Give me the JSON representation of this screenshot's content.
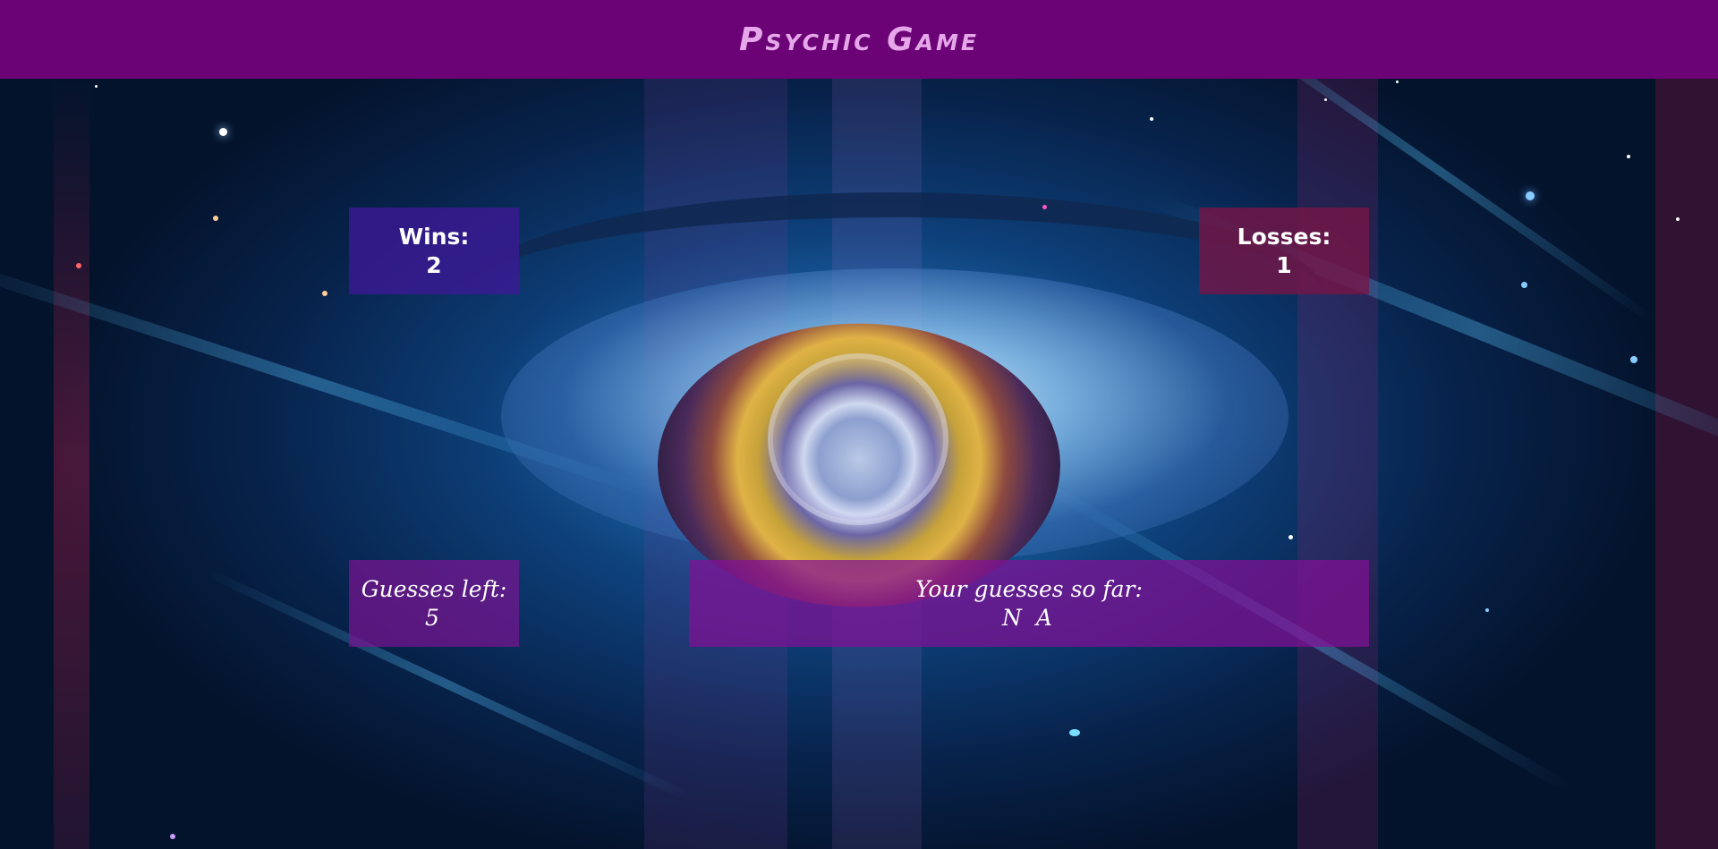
{
  "header": {
    "title": "Psychic Game"
  },
  "stats": {
    "wins_label": "Wins:",
    "wins_value": "2",
    "losses_label": "Losses:",
    "losses_value": "1",
    "guesses_left_label": "Guesses left:",
    "guesses_left_value": "5",
    "guesses_so_far_label": "Your guesses so far:",
    "guesses_so_far_value": "N A"
  },
  "colors": {
    "header_bg": "#6b0275",
    "title_text": "#e6a7ea",
    "wins_panel": "#3c1896",
    "losses_panel": "#781446",
    "guess_panels": "#820f96"
  },
  "background": {
    "icon": "cosmic-eye-image"
  }
}
